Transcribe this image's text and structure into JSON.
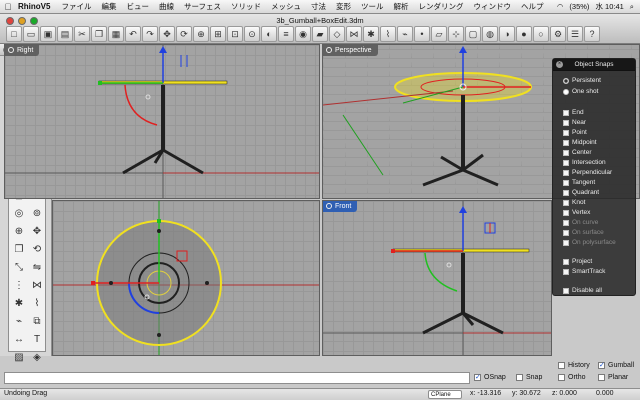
{
  "menubar": {
    "app_name": "RhinoV5",
    "items": [
      "ファイル",
      "編集",
      "ビュー",
      "曲線",
      "サーフェス",
      "ソリッド",
      "メッシュ",
      "寸法",
      "変形",
      "ツール",
      "解析",
      "レンダリング",
      "ウィンドウ",
      "ヘルプ"
    ],
    "battery": "(35%)",
    "clock": "水 10:41"
  },
  "window": {
    "title": "3b_Gumball+BoxEdit.3dm"
  },
  "viewports": {
    "right": "Right",
    "perspective": "Perspective",
    "top": "",
    "front": "Front"
  },
  "osnap": {
    "title": "Object Snaps",
    "close": "×",
    "modes": [
      {
        "label": "Persistent",
        "on": true
      },
      {
        "label": "One shot",
        "on": false
      }
    ],
    "snaps": [
      "End",
      "Near",
      "Point",
      "Midpoint",
      "Center",
      "Intersection",
      "Perpendicular",
      "Tangent",
      "Quadrant",
      "Knot",
      "Vertex"
    ],
    "dim_snaps": [
      "On curve",
      "On surface",
      "On polysurface"
    ],
    "extras": [
      "Project",
      "SmartTrack"
    ],
    "disable": "Disable all"
  },
  "options": {
    "history": "History",
    "gumball": "Gumball",
    "osnap": "OSnap",
    "snap": "Snap",
    "ortho": "Ortho",
    "planar": "Planar"
  },
  "status": {
    "message": "Undoing Drag",
    "cplane": "CPlane",
    "x": "x: -13.316",
    "y": "y: 30.672",
    "z": "z: 0.000",
    "w": "0.000"
  },
  "colors": {
    "viewport_bg": "#a3a3a3",
    "active_label": "#2f5fb3",
    "gumball_x": "#e02020",
    "gumball_y": "#20c020",
    "gumball_z": "#2040e0",
    "selection": "#f0e020"
  }
}
